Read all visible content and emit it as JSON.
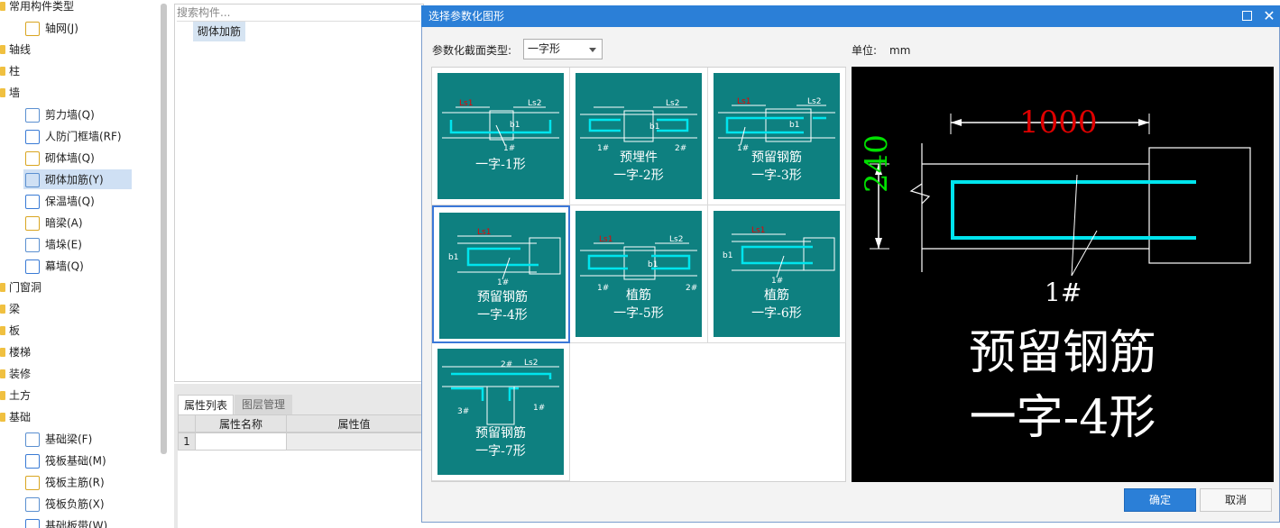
{
  "tree": {
    "items": [
      {
        "label": "常用构件类型",
        "kind": "cat"
      },
      {
        "label": "轴网(J)",
        "kind": "child",
        "icon": "axis-grid-icon"
      },
      {
        "label": "轴线",
        "kind": "cat"
      },
      {
        "label": "柱",
        "kind": "cat"
      },
      {
        "label": "墙",
        "kind": "cat"
      },
      {
        "label": "剪力墙(Q)",
        "kind": "child",
        "icon": "shear-wall-icon"
      },
      {
        "label": "人防门框墙(RF)",
        "kind": "child",
        "icon": "door-frame-wall-icon"
      },
      {
        "label": "砌体墙(Q)",
        "kind": "child",
        "icon": "masonry-wall-icon"
      },
      {
        "label": "砌体加筋(Y)",
        "kind": "child",
        "icon": "masonry-rebar-icon"
      },
      {
        "label": "保温墙(Q)",
        "kind": "child",
        "icon": "insulation-wall-icon"
      },
      {
        "label": "暗梁(A)",
        "kind": "child",
        "icon": "hidden-beam-icon"
      },
      {
        "label": "墙垛(E)",
        "kind": "child",
        "icon": "wall-pier-icon"
      },
      {
        "label": "幕墙(Q)",
        "kind": "child",
        "icon": "curtain-wall-icon"
      },
      {
        "label": "门窗洞",
        "kind": "cat"
      },
      {
        "label": "梁",
        "kind": "cat"
      },
      {
        "label": "板",
        "kind": "cat"
      },
      {
        "label": "楼梯",
        "kind": "cat"
      },
      {
        "label": "装修",
        "kind": "cat"
      },
      {
        "label": "土方",
        "kind": "cat"
      },
      {
        "label": "基础",
        "kind": "cat"
      },
      {
        "label": "基础梁(F)",
        "kind": "child",
        "icon": "foundation-beam-icon"
      },
      {
        "label": "筏板基础(M)",
        "kind": "child",
        "icon": "raft-foundation-icon"
      },
      {
        "label": "筏板主筋(R)",
        "kind": "child",
        "icon": "raft-main-rebar-icon"
      },
      {
        "label": "筏板负筋(X)",
        "kind": "child",
        "icon": "raft-neg-rebar-icon"
      },
      {
        "label": "基础板带(W)",
        "kind": "child",
        "icon": "foundation-strip-icon"
      }
    ]
  },
  "middle": {
    "search_placeholder": "搜索构件...",
    "selected_component": "砌体加筋"
  },
  "props": {
    "tabs": [
      "属性列表",
      "图层管理"
    ],
    "col_name": "属性名称",
    "col_value": "属性值",
    "row1_index": "1"
  },
  "dialog": {
    "title": "选择参数化图形",
    "type_label": "参数化截面类型:",
    "type_value": "一字形",
    "unit_label": "单位:",
    "unit_value": "mm",
    "ok_label": "确定",
    "cancel_label": "取消",
    "thumbs": [
      {
        "lines": [
          "一字-1形"
        ]
      },
      {
        "lines": [
          "预埋件",
          "一字-2形"
        ]
      },
      {
        "lines": [
          "预留钢筋",
          "一字-3形"
        ]
      },
      {
        "lines": [
          "预留钢筋",
          "一字-4形"
        ],
        "selected": true
      },
      {
        "lines": [
          "植筋",
          "一字-5形"
        ]
      },
      {
        "lines": [
          "植筋",
          "一字-6形"
        ]
      },
      {
        "lines": [
          "预留钢筋",
          "一字-7形"
        ]
      }
    ],
    "thumb_marks": {
      "ls1": "Ls1",
      "ls2": "Ls2",
      "b1": "b1",
      "bar1": "1#",
      "bar2": "2#",
      "bar3": "3#"
    },
    "preview": {
      "dim_length": "1000",
      "dim_width": "240",
      "bar_mark": "1#",
      "line1": "预留钢筋",
      "line2": "一字-4形",
      "colors": {
        "length": "#e00000",
        "width": "#00e000",
        "rebar": "#00e5ee"
      }
    }
  }
}
